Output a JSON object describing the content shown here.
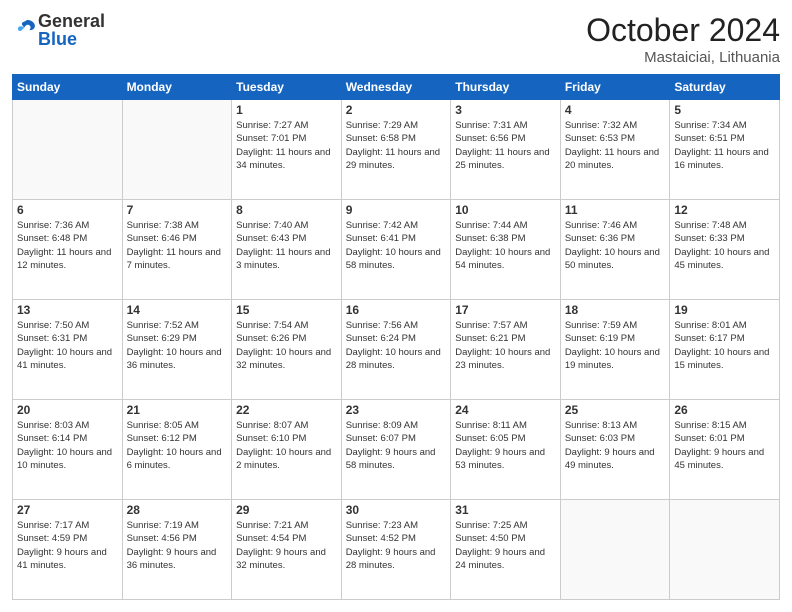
{
  "header": {
    "logo_general": "General",
    "logo_blue": "Blue",
    "month_title": "October 2024",
    "location": "Mastaiciai, Lithuania"
  },
  "days_of_week": [
    "Sunday",
    "Monday",
    "Tuesday",
    "Wednesday",
    "Thursday",
    "Friday",
    "Saturday"
  ],
  "weeks": [
    [
      {
        "num": "",
        "sunrise": "",
        "sunset": "",
        "daylight": ""
      },
      {
        "num": "",
        "sunrise": "",
        "sunset": "",
        "daylight": ""
      },
      {
        "num": "1",
        "sunrise": "Sunrise: 7:27 AM",
        "sunset": "Sunset: 7:01 PM",
        "daylight": "Daylight: 11 hours and 34 minutes."
      },
      {
        "num": "2",
        "sunrise": "Sunrise: 7:29 AM",
        "sunset": "Sunset: 6:58 PM",
        "daylight": "Daylight: 11 hours and 29 minutes."
      },
      {
        "num": "3",
        "sunrise": "Sunrise: 7:31 AM",
        "sunset": "Sunset: 6:56 PM",
        "daylight": "Daylight: 11 hours and 25 minutes."
      },
      {
        "num": "4",
        "sunrise": "Sunrise: 7:32 AM",
        "sunset": "Sunset: 6:53 PM",
        "daylight": "Daylight: 11 hours and 20 minutes."
      },
      {
        "num": "5",
        "sunrise": "Sunrise: 7:34 AM",
        "sunset": "Sunset: 6:51 PM",
        "daylight": "Daylight: 11 hours and 16 minutes."
      }
    ],
    [
      {
        "num": "6",
        "sunrise": "Sunrise: 7:36 AM",
        "sunset": "Sunset: 6:48 PM",
        "daylight": "Daylight: 11 hours and 12 minutes."
      },
      {
        "num": "7",
        "sunrise": "Sunrise: 7:38 AM",
        "sunset": "Sunset: 6:46 PM",
        "daylight": "Daylight: 11 hours and 7 minutes."
      },
      {
        "num": "8",
        "sunrise": "Sunrise: 7:40 AM",
        "sunset": "Sunset: 6:43 PM",
        "daylight": "Daylight: 11 hours and 3 minutes."
      },
      {
        "num": "9",
        "sunrise": "Sunrise: 7:42 AM",
        "sunset": "Sunset: 6:41 PM",
        "daylight": "Daylight: 10 hours and 58 minutes."
      },
      {
        "num": "10",
        "sunrise": "Sunrise: 7:44 AM",
        "sunset": "Sunset: 6:38 PM",
        "daylight": "Daylight: 10 hours and 54 minutes."
      },
      {
        "num": "11",
        "sunrise": "Sunrise: 7:46 AM",
        "sunset": "Sunset: 6:36 PM",
        "daylight": "Daylight: 10 hours and 50 minutes."
      },
      {
        "num": "12",
        "sunrise": "Sunrise: 7:48 AM",
        "sunset": "Sunset: 6:33 PM",
        "daylight": "Daylight: 10 hours and 45 minutes."
      }
    ],
    [
      {
        "num": "13",
        "sunrise": "Sunrise: 7:50 AM",
        "sunset": "Sunset: 6:31 PM",
        "daylight": "Daylight: 10 hours and 41 minutes."
      },
      {
        "num": "14",
        "sunrise": "Sunrise: 7:52 AM",
        "sunset": "Sunset: 6:29 PM",
        "daylight": "Daylight: 10 hours and 36 minutes."
      },
      {
        "num": "15",
        "sunrise": "Sunrise: 7:54 AM",
        "sunset": "Sunset: 6:26 PM",
        "daylight": "Daylight: 10 hours and 32 minutes."
      },
      {
        "num": "16",
        "sunrise": "Sunrise: 7:56 AM",
        "sunset": "Sunset: 6:24 PM",
        "daylight": "Daylight: 10 hours and 28 minutes."
      },
      {
        "num": "17",
        "sunrise": "Sunrise: 7:57 AM",
        "sunset": "Sunset: 6:21 PM",
        "daylight": "Daylight: 10 hours and 23 minutes."
      },
      {
        "num": "18",
        "sunrise": "Sunrise: 7:59 AM",
        "sunset": "Sunset: 6:19 PM",
        "daylight": "Daylight: 10 hours and 19 minutes."
      },
      {
        "num": "19",
        "sunrise": "Sunrise: 8:01 AM",
        "sunset": "Sunset: 6:17 PM",
        "daylight": "Daylight: 10 hours and 15 minutes."
      }
    ],
    [
      {
        "num": "20",
        "sunrise": "Sunrise: 8:03 AM",
        "sunset": "Sunset: 6:14 PM",
        "daylight": "Daylight: 10 hours and 10 minutes."
      },
      {
        "num": "21",
        "sunrise": "Sunrise: 8:05 AM",
        "sunset": "Sunset: 6:12 PM",
        "daylight": "Daylight: 10 hours and 6 minutes."
      },
      {
        "num": "22",
        "sunrise": "Sunrise: 8:07 AM",
        "sunset": "Sunset: 6:10 PM",
        "daylight": "Daylight: 10 hours and 2 minutes."
      },
      {
        "num": "23",
        "sunrise": "Sunrise: 8:09 AM",
        "sunset": "Sunset: 6:07 PM",
        "daylight": "Daylight: 9 hours and 58 minutes."
      },
      {
        "num": "24",
        "sunrise": "Sunrise: 8:11 AM",
        "sunset": "Sunset: 6:05 PM",
        "daylight": "Daylight: 9 hours and 53 minutes."
      },
      {
        "num": "25",
        "sunrise": "Sunrise: 8:13 AM",
        "sunset": "Sunset: 6:03 PM",
        "daylight": "Daylight: 9 hours and 49 minutes."
      },
      {
        "num": "26",
        "sunrise": "Sunrise: 8:15 AM",
        "sunset": "Sunset: 6:01 PM",
        "daylight": "Daylight: 9 hours and 45 minutes."
      }
    ],
    [
      {
        "num": "27",
        "sunrise": "Sunrise: 7:17 AM",
        "sunset": "Sunset: 4:59 PM",
        "daylight": "Daylight: 9 hours and 41 minutes."
      },
      {
        "num": "28",
        "sunrise": "Sunrise: 7:19 AM",
        "sunset": "Sunset: 4:56 PM",
        "daylight": "Daylight: 9 hours and 36 minutes."
      },
      {
        "num": "29",
        "sunrise": "Sunrise: 7:21 AM",
        "sunset": "Sunset: 4:54 PM",
        "daylight": "Daylight: 9 hours and 32 minutes."
      },
      {
        "num": "30",
        "sunrise": "Sunrise: 7:23 AM",
        "sunset": "Sunset: 4:52 PM",
        "daylight": "Daylight: 9 hours and 28 minutes."
      },
      {
        "num": "31",
        "sunrise": "Sunrise: 7:25 AM",
        "sunset": "Sunset: 4:50 PM",
        "daylight": "Daylight: 9 hours and 24 minutes."
      },
      {
        "num": "",
        "sunrise": "",
        "sunset": "",
        "daylight": ""
      },
      {
        "num": "",
        "sunrise": "",
        "sunset": "",
        "daylight": ""
      }
    ]
  ]
}
